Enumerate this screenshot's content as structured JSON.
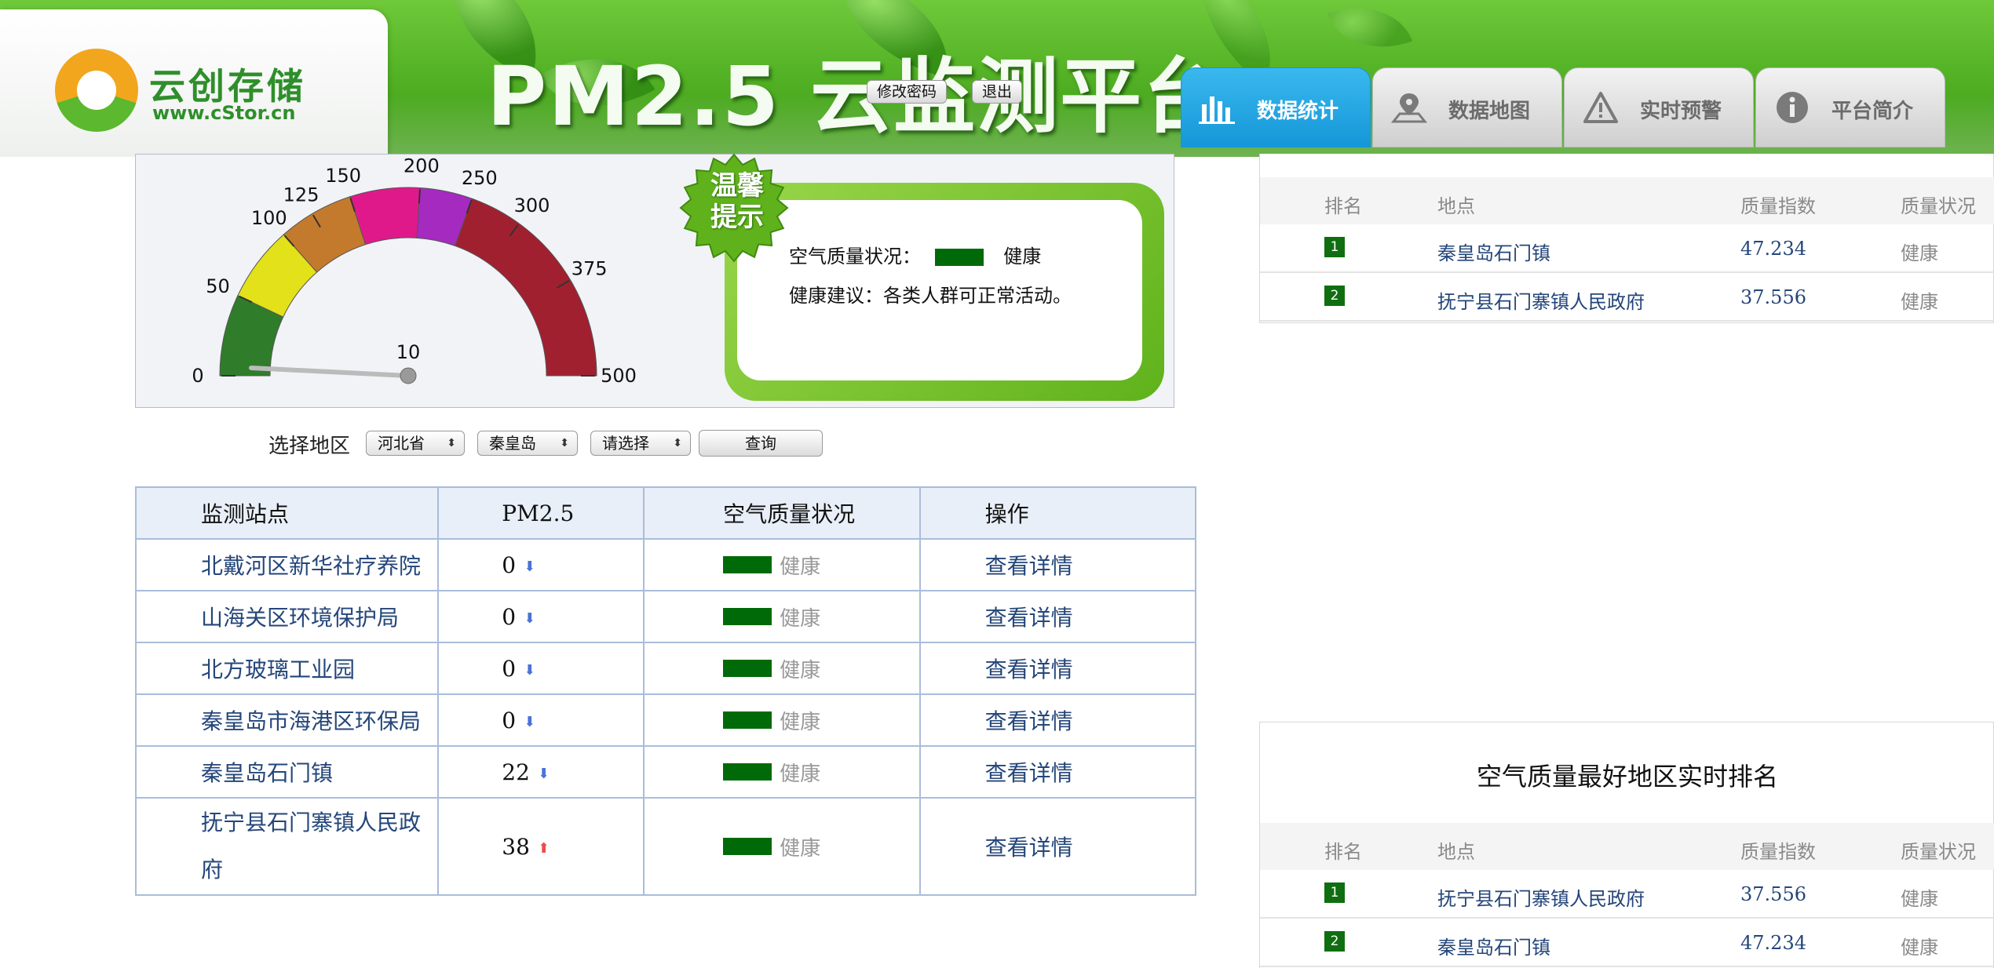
{
  "header": {
    "logo_name": "云创存储",
    "logo_url": "www.cStor.cn",
    "site_title": "PM2.5 云监测平台",
    "change_password_label": "修改密码",
    "logout_label": "退出",
    "nav_tabs": [
      {
        "label": "数据统计",
        "icon": "bar-chart-icon",
        "active": true
      },
      {
        "label": "数据地图",
        "icon": "map-pin-icon",
        "active": false
      },
      {
        "label": "实时预警",
        "icon": "warning-icon",
        "active": false
      },
      {
        "label": "平台简介",
        "icon": "info-icon",
        "active": false
      }
    ]
  },
  "gauge": {
    "ticks": [
      "0",
      "50",
      "100",
      "125",
      "150",
      "200",
      "250",
      "300",
      "375",
      "500"
    ],
    "current_value": "10",
    "band_colors": [
      "#2f7d2a",
      "#e2e11a",
      "#c47a2c",
      "#e0198b",
      "#a52ac0",
      "#a02030"
    ]
  },
  "tip": {
    "badge": "温馨提示",
    "aq_label": "空气质量状况：",
    "aq_status": "健康",
    "aq_color": "#006a09",
    "advice": "健康建议：各类人群可正常活动。"
  },
  "region": {
    "label": "选择地区",
    "province": "河北省",
    "city": "秦皇岛",
    "district": "请选择",
    "query_label": "查询"
  },
  "stations": {
    "headers": [
      "监测站点",
      "PM2.5",
      "空气质量状况",
      "操作"
    ],
    "rows": [
      {
        "name": "北戴河区新华社疗养院",
        "pm25": "0",
        "trend": "down",
        "status": "健康",
        "action": "查看详情"
      },
      {
        "name": "山海关区环境保护局",
        "pm25": "0",
        "trend": "down",
        "status": "健康",
        "action": "查看详情"
      },
      {
        "name": "北方玻璃工业园",
        "pm25": "0",
        "trend": "down",
        "status": "健康",
        "action": "查看详情"
      },
      {
        "name": "秦皇岛市海港区环保局",
        "pm25": "0",
        "trend": "down",
        "status": "健康",
        "action": "查看详情"
      },
      {
        "name": "秦皇岛石门镇",
        "pm25": "22",
        "trend": "down",
        "status": "健康",
        "action": "查看详情"
      },
      {
        "name": "抚宁县石门寨镇人民政府",
        "pm25": "38",
        "trend": "up",
        "status": "健康",
        "action": "查看详情"
      }
    ]
  },
  "rank_worst": {
    "headers": [
      "排名",
      "地点",
      "质量指数",
      "质量状况"
    ],
    "rows": [
      {
        "rank": "1",
        "place": "秦皇岛石门镇",
        "index": "47.234",
        "status": "健康"
      },
      {
        "rank": "2",
        "place": "抚宁县石门寨镇人民政府",
        "index": "37.556",
        "status": "健康"
      }
    ]
  },
  "rank_best": {
    "title": "空气质量最好地区实时排名",
    "headers": [
      "排名",
      "地点",
      "质量指数",
      "质量状况"
    ],
    "rows": [
      {
        "rank": "1",
        "place": "抚宁县石门寨镇人民政府",
        "index": "37.556",
        "status": "健康"
      },
      {
        "rank": "2",
        "place": "秦皇岛石门镇",
        "index": "47.234",
        "status": "健康"
      }
    ]
  }
}
